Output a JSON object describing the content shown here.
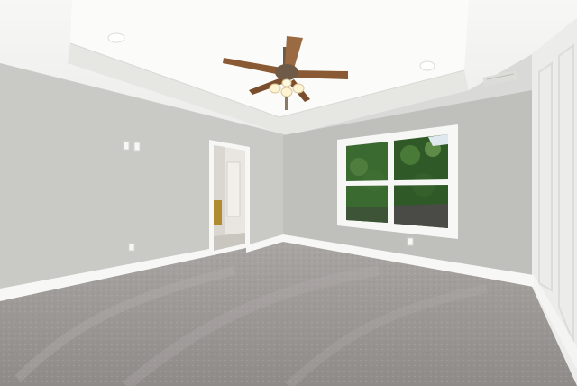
{
  "scene": {
    "description_visible_text": "",
    "colors": {
      "ceiling": "#f4f4f2",
      "ceiling_tray": "#fafaf8",
      "wall_left": "#c9cac6",
      "wall_back": "#bfc0bc",
      "wall_right": "#e9e9e7",
      "trim": "#f7f7f5",
      "carpet": "#9e9a98",
      "carpet_light": "#b3afad",
      "fan_blade": "#8a5a35",
      "fan_metal": "#6f5a48",
      "foliage": "#2f5a27",
      "doorway_interior": "#e8e6e0"
    },
    "icons": [
      "ceiling-fan",
      "recessed-light",
      "window",
      "doorway",
      "electrical-outlet",
      "light-switch",
      "hvac-vent"
    ]
  }
}
